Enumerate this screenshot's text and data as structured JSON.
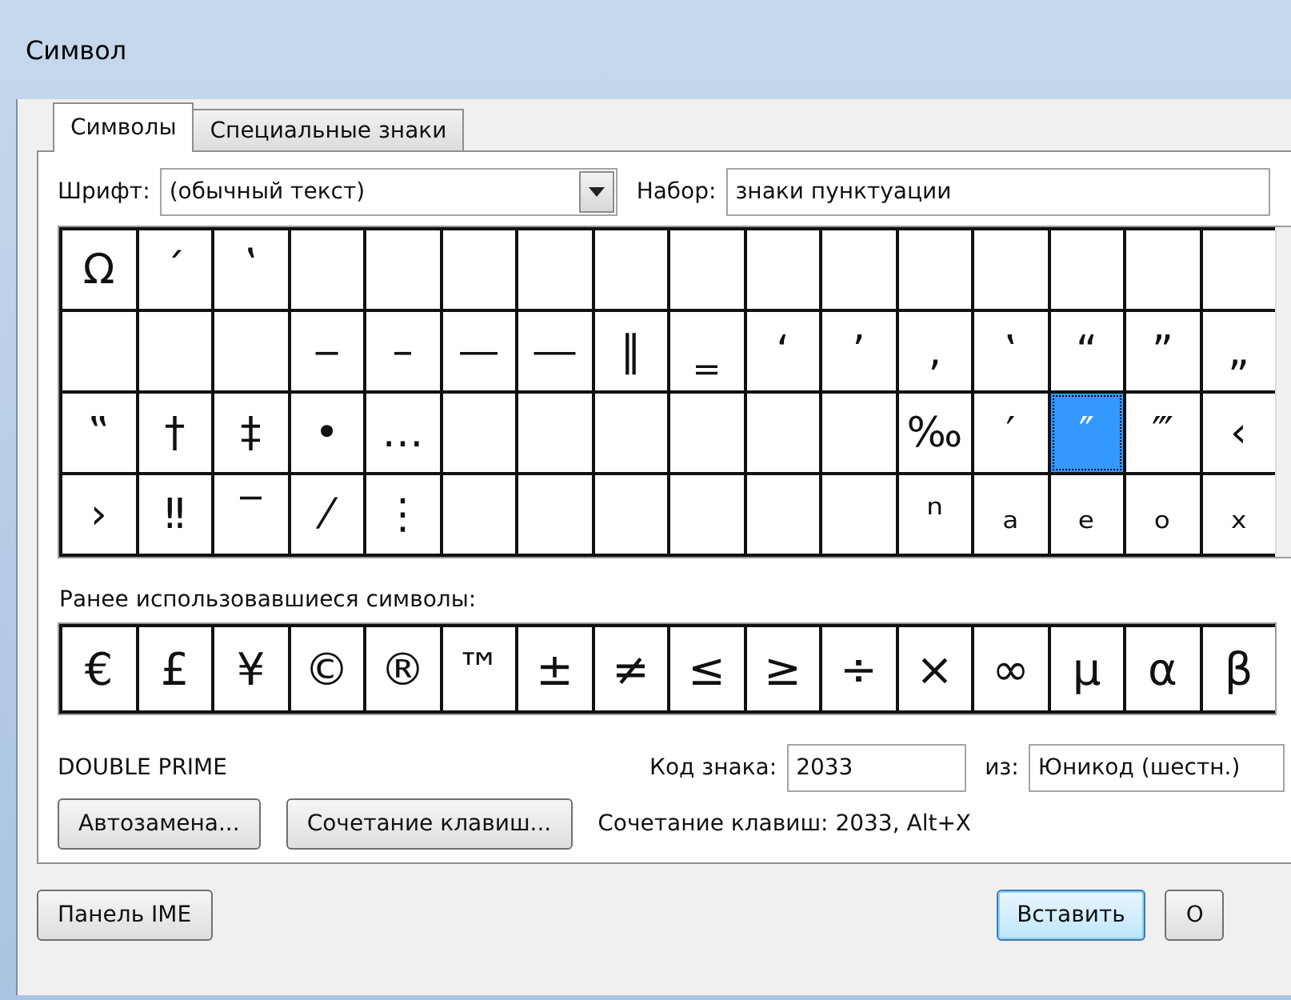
{
  "window": {
    "title": "Символ"
  },
  "tabs": [
    {
      "label": "Символы",
      "selected": true
    },
    {
      "label": "Специальные знаки",
      "selected": false
    }
  ],
  "font": {
    "label": "Шрифт:",
    "value": "(обычный текст)"
  },
  "subset": {
    "label": "Набор:",
    "value": "знаки пунктуации"
  },
  "symbol_grid": {
    "cells": [
      {
        "char": "Ω",
        "selected": false
      },
      {
        "char": "´",
        "selected": false
      },
      {
        "char": "ʽ",
        "selected": false
      },
      {
        "selected": false
      },
      {
        "selected": false
      },
      {
        "selected": false
      },
      {
        "selected": false
      },
      {
        "selected": false
      },
      {
        "selected": false
      },
      {
        "selected": false
      },
      {
        "selected": false
      },
      {
        "selected": false
      },
      {
        "selected": false
      },
      {
        "selected": false
      },
      {
        "selected": false
      },
      {
        "selected": false
      },
      {
        "selected": false
      },
      {
        "selected": false
      },
      {
        "selected": false
      },
      {
        "char": "‒",
        "selected": false
      },
      {
        "char": "–",
        "selected": false
      },
      {
        "char": "—",
        "selected": false
      },
      {
        "char": "―",
        "selected": false
      },
      {
        "char": "‖",
        "selected": false
      },
      {
        "char": "‗",
        "selected": false
      },
      {
        "char": "‘",
        "selected": false
      },
      {
        "char": "’",
        "selected": false
      },
      {
        "char": "‚",
        "selected": false
      },
      {
        "char": "‛",
        "selected": false
      },
      {
        "char": "“",
        "selected": false
      },
      {
        "char": "”",
        "selected": false
      },
      {
        "char": "„",
        "selected": false
      },
      {
        "char": "‟",
        "selected": false
      },
      {
        "char": "†",
        "selected": false
      },
      {
        "char": "‡",
        "selected": false
      },
      {
        "char": "•",
        "selected": false
      },
      {
        "char": "…",
        "selected": false
      },
      {
        "selected": false
      },
      {
        "selected": false
      },
      {
        "selected": false
      },
      {
        "selected": false
      },
      {
        "selected": false
      },
      {
        "selected": false
      },
      {
        "char": "‰",
        "selected": false
      },
      {
        "char": "′",
        "selected": false
      },
      {
        "char": "″",
        "selected": true
      },
      {
        "char": "‴",
        "selected": false
      },
      {
        "char": "‹",
        "selected": false
      },
      {
        "char": "›",
        "selected": false
      },
      {
        "char": "‼",
        "selected": false
      },
      {
        "char": "‾",
        "selected": false
      },
      {
        "char": "⁄",
        "selected": false
      },
      {
        "char": "⋮",
        "selected": false
      },
      {
        "selected": false
      },
      {
        "selected": false
      },
      {
        "selected": false
      },
      {
        "selected": false
      },
      {
        "selected": false
      },
      {
        "selected": false
      },
      {
        "char": "ⁿ",
        "selected": false
      },
      {
        "char": "ₐ",
        "selected": false
      },
      {
        "char": "ₑ",
        "selected": false
      },
      {
        "char": "ₒ",
        "selected": false
      },
      {
        "char": "ₓ",
        "selected": false
      }
    ]
  },
  "recent": {
    "label": "Ранее использовавшиеся символы:",
    "symbols": [
      "€",
      "£",
      "¥",
      "©",
      "®",
      "™",
      "±",
      "≠",
      "≤",
      "≥",
      "÷",
      "×",
      "∞",
      "μ",
      "α",
      "β"
    ]
  },
  "char_name": "DOUBLE PRIME",
  "code": {
    "label": "Код знака:",
    "value": "2033"
  },
  "from": {
    "label": "из:",
    "value": "Юникод (шестн.)"
  },
  "buttons": [
    {
      "label": "Автозамена..."
    },
    {
      "label": "Сочетание клавиш..."
    }
  ],
  "shortcut": "Сочетание клавиш: 2033, Alt+X",
  "footer_buttons": [
    {
      "label": "Панель IME",
      "default": false
    },
    {
      "label": "Вставить",
      "default": true
    },
    {
      "label": "О",
      "default": false
    }
  ]
}
